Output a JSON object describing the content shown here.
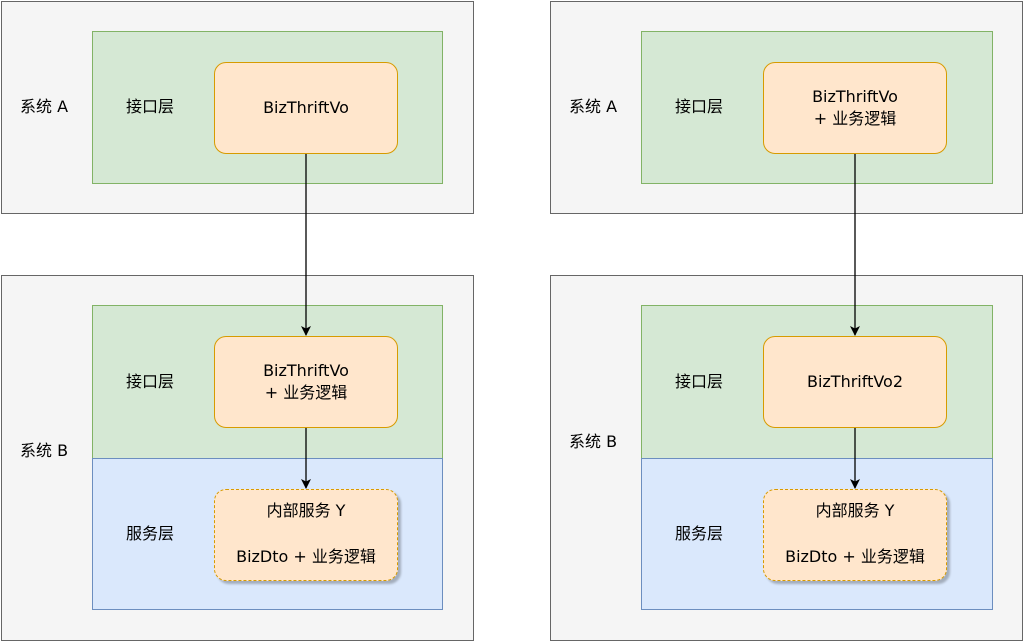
{
  "left": {
    "system_a": {
      "label": "系统 A",
      "interface_layer": {
        "label": "接口层",
        "node": [
          "BizThriftVo"
        ]
      }
    },
    "system_b": {
      "label": "系统 B",
      "interface_layer": {
        "label": "接口层",
        "node": [
          "BizThriftVo",
          "+ 业务逻辑"
        ]
      },
      "service_layer": {
        "label": "服务层",
        "node": [
          "内部服务 Y",
          "BizDto + 业务逻辑"
        ]
      }
    }
  },
  "right": {
    "system_a": {
      "label": "系统 A",
      "interface_layer": {
        "label": "接口层",
        "node": [
          "BizThriftVo",
          "+ 业务逻辑"
        ]
      }
    },
    "system_b": {
      "label": "系统 B",
      "interface_layer": {
        "label": "接口层",
        "node": [
          "BizThriftVo2"
        ]
      },
      "service_layer": {
        "label": "服务层",
        "node": [
          "内部服务 Y",
          "BizDto + 业务逻辑"
        ]
      }
    }
  },
  "colors": {
    "system_fill": "#f5f5f5",
    "system_stroke": "#666666",
    "interface_fill": "#d5e8d4",
    "interface_stroke": "#82b366",
    "service_fill": "#dae8fc",
    "service_stroke": "#6c8ebf",
    "node_fill": "#ffe6cc",
    "node_stroke": "#d79b00",
    "edge": "#000000"
  }
}
